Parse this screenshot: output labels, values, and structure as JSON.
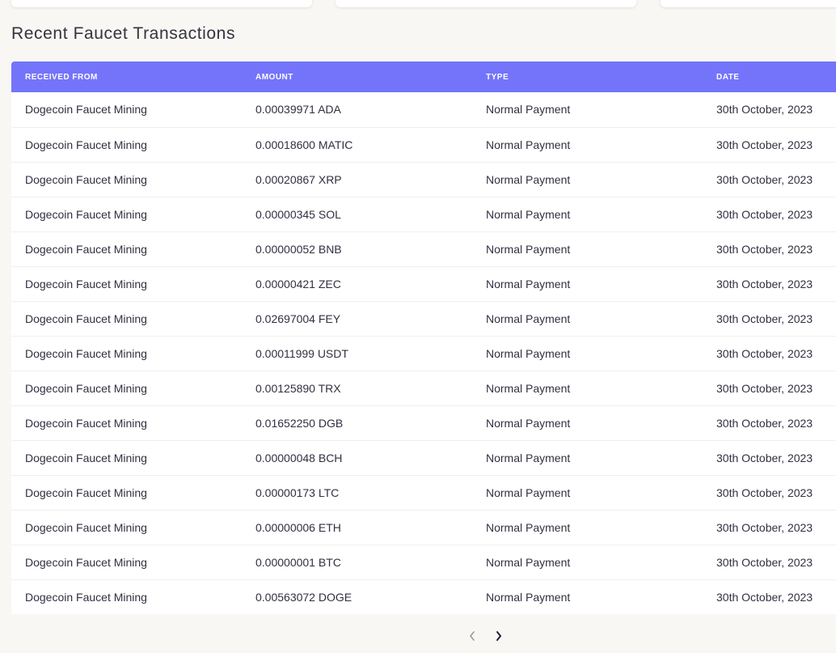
{
  "section_title": "Recent Faucet Transactions",
  "table": {
    "columns": [
      "RECEIVED FROM",
      "AMOUNT",
      "TYPE",
      "DATE"
    ],
    "rows": [
      [
        "Dogecoin Faucet Mining",
        "0.00039971 ADA",
        "Normal Payment",
        "30th October, 2023"
      ],
      [
        "Dogecoin Faucet Mining",
        "0.00018600 MATIC",
        "Normal Payment",
        "30th October, 2023"
      ],
      [
        "Dogecoin Faucet Mining",
        "0.00020867 XRP",
        "Normal Payment",
        "30th October, 2023"
      ],
      [
        "Dogecoin Faucet Mining",
        "0.00000345 SOL",
        "Normal Payment",
        "30th October, 2023"
      ],
      [
        "Dogecoin Faucet Mining",
        "0.00000052 BNB",
        "Normal Payment",
        "30th October, 2023"
      ],
      [
        "Dogecoin Faucet Mining",
        "0.00000421 ZEC",
        "Normal Payment",
        "30th October, 2023"
      ],
      [
        "Dogecoin Faucet Mining",
        "0.02697004 FEY",
        "Normal Payment",
        "30th October, 2023"
      ],
      [
        "Dogecoin Faucet Mining",
        "0.00011999 USDT",
        "Normal Payment",
        "30th October, 2023"
      ],
      [
        "Dogecoin Faucet Mining",
        "0.00125890 TRX",
        "Normal Payment",
        "30th October, 2023"
      ],
      [
        "Dogecoin Faucet Mining",
        "0.01652250 DGB",
        "Normal Payment",
        "30th October, 2023"
      ],
      [
        "Dogecoin Faucet Mining",
        "0.00000048 BCH",
        "Normal Payment",
        "30th October, 2023"
      ],
      [
        "Dogecoin Faucet Mining",
        "0.00000173 LTC",
        "Normal Payment",
        "30th October, 2023"
      ],
      [
        "Dogecoin Faucet Mining",
        "0.00000006 ETH",
        "Normal Payment",
        "30th October, 2023"
      ],
      [
        "Dogecoin Faucet Mining",
        "0.00000001 BTC",
        "Normal Payment",
        "30th October, 2023"
      ],
      [
        "Dogecoin Faucet Mining",
        "0.00563072 DOGE",
        "Normal Payment",
        "30th October, 2023"
      ]
    ]
  },
  "pagination": {
    "prev_icon": "chevron-left-icon",
    "next_icon": "chevron-right-icon",
    "prev_enabled": false,
    "next_enabled": true
  },
  "colors": {
    "header_bg": "#7474fb",
    "page_bg": "#f8f7f4",
    "text": "#2f3140"
  }
}
